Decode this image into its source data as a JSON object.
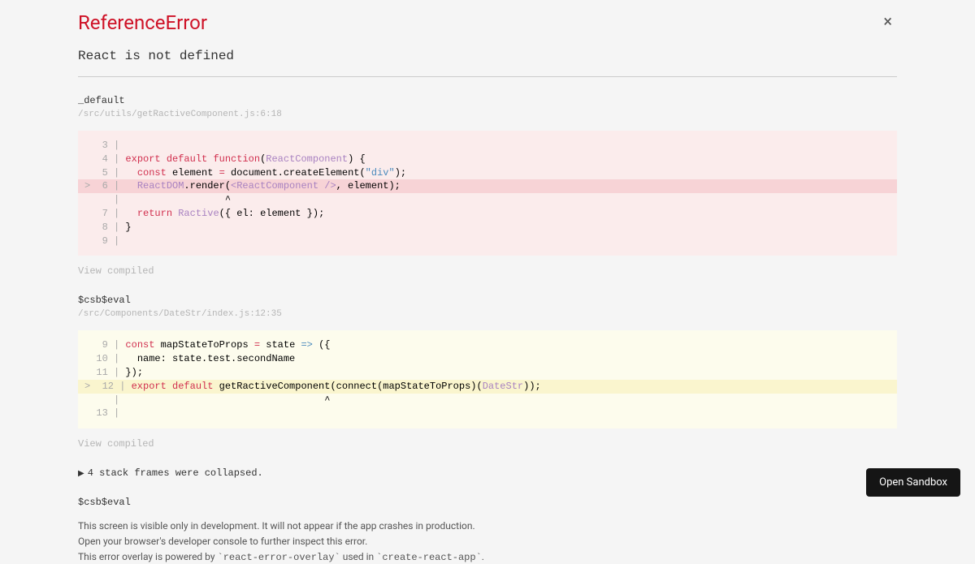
{
  "header": {
    "error_type": "ReferenceError",
    "error_message": "React is not defined",
    "close_label": "×"
  },
  "frame1": {
    "fn": "_default",
    "loc": "/src/utils/getRactiveComponent.js:6:18",
    "code": {
      "l3g": "   3 | ",
      "l4g": "   4 | ",
      "l4a": "export default function",
      "l4b": "(",
      "l4c": "ReactComponent",
      "l4d": ") {",
      "l5g": "   5 |   ",
      "l5a": "const",
      "l5b": " element ",
      "l5c": "=",
      "l5d": " document.createElement(",
      "l5e": "\"div\"",
      "l5f": ");",
      "l6g": ">  6 |   ",
      "l6a": "ReactDOM",
      "l6b": ".render(",
      "l6c": "<ReactComponent />",
      "l6d": ", element);",
      "lcg": "     |                  ",
      "lcc": "^",
      "l7g": "   7 |   ",
      "l7a": "return ",
      "l7b": "Ractive",
      "l7c": "({ el: element });",
      "l8g": "   8 | ",
      "l8a": "}",
      "l9g": "   9 | "
    },
    "view": "View compiled"
  },
  "frame2": {
    "fn": "$csb$eval",
    "loc": "/src/Components/DateStr/index.js:12:35",
    "code": {
      "l9g": "   9 | ",
      "l9a": "const",
      "l9b": " mapStateToProps ",
      "l9c": "=",
      "l9d": " state ",
      "l9e": "=>",
      "l9f": " ({",
      "l10g": "  10 |   ",
      "l10a": "name: state.test.secondName",
      "l11g": "  11 | ",
      "l11a": "});",
      "l12g": ">  12 | ",
      "l12a": "export default",
      "l12b": " getRactiveComponent(connect(mapStateToProps)(",
      "l12c": "DateStr",
      "l12d": "));",
      "lcg": "     |                                   ",
      "lcc": "^",
      "l13g": "  13 | "
    },
    "view": "View compiled"
  },
  "collapsed": "4 stack frames were collapsed.",
  "frame3": {
    "fn": "$csb$eval"
  },
  "footer": {
    "line1": "This screen is visible only in development. It will not appear if the app crashes in production.",
    "line2": "Open your browser's developer console to further inspect this error.",
    "line3a": "This error overlay is powered by ",
    "line3b": "`react-error-overlay`",
    "line3c": " used in ",
    "line3d": "`create-react-app`",
    "line3e": "."
  },
  "sandbox_btn": "Open Sandbox"
}
